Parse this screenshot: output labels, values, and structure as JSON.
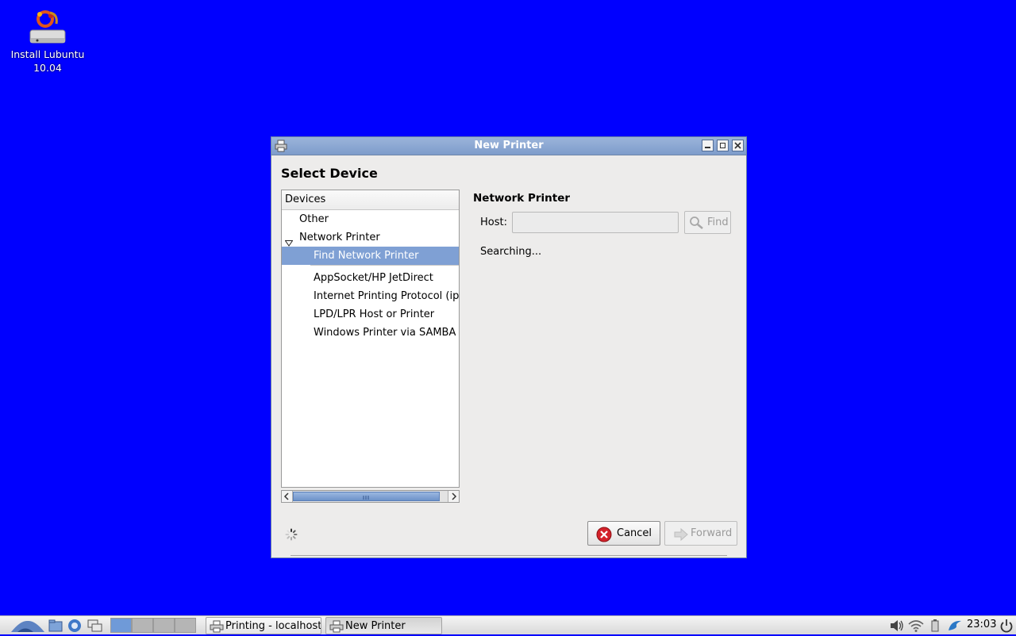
{
  "desktop": {
    "icons": [
      {
        "name": "install-lubuntu",
        "label_line1": "Install Lubuntu",
        "label_line2": "10.04"
      }
    ],
    "background_color": "#0000ff"
  },
  "window": {
    "title": "New Printer",
    "heading": "Select Device",
    "devices_header": "Devices",
    "tree": {
      "other": "Other",
      "network_printer": "Network Printer",
      "find_network_printer": "Find Network Printer",
      "appsocket": "AppSocket/HP JetDirect",
      "ipp": "Internet Printing Protocol (ipp)",
      "lpd": "LPD/LPR Host or Printer",
      "samba": "Windows Printer via SAMBA"
    },
    "panel": {
      "title": "Network Printer",
      "host_label": "Host:",
      "host_value": "",
      "find_label": "Find",
      "status": "Searching..."
    },
    "buttons": {
      "cancel": "Cancel",
      "forward": "Forward"
    }
  },
  "taskbar": {
    "tasks": [
      {
        "label": "Printing - localhost"
      },
      {
        "label": "New Printer"
      }
    ],
    "clock": "23:03",
    "accent_color": "#6f9ad8"
  }
}
